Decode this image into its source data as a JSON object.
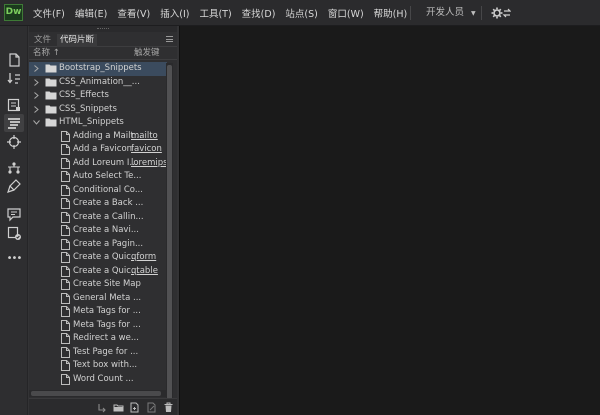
{
  "app": {
    "logo_text": "Dw",
    "logo_color": "#7dce5e",
    "menu": [
      "文件(F)",
      "编辑(E)",
      "查看(V)",
      "插入(I)",
      "工具(T)",
      "查找(D)",
      "站点(S)",
      "窗口(W)",
      "帮助(H)"
    ],
    "workspace_label": "开发人员",
    "sync_icon": "gear-sync-icon"
  },
  "toolbar": {
    "icons": [
      "file-icon",
      "file-transfer-icon",
      "split-view-icon",
      "live-view-icon",
      "snippets-icon",
      "target-icon",
      "dom-icon",
      "paint-icon",
      "comment-icon",
      "check-icon",
      "more-icon"
    ],
    "more_label": "•••"
  },
  "panel": {
    "tabs": [
      "文件",
      "代码片断"
    ],
    "active_tab": "代码片断",
    "col_name": "名称 ↑",
    "col_key": "触发键",
    "accent_selected": "#3b4b5e"
  },
  "snippets": [
    {
      "type": "folder",
      "label": "Bootstrap_Snippets",
      "expanded": false,
      "selected": true
    },
    {
      "type": "folder",
      "label": "CSS_Animation__...",
      "expanded": false
    },
    {
      "type": "folder",
      "label": "CSS_Effects",
      "expanded": false
    },
    {
      "type": "folder",
      "label": "CSS_Snippets",
      "expanded": false
    },
    {
      "type": "folder",
      "label": "HTML_Snippets",
      "expanded": true
    },
    {
      "type": "file",
      "label": "Adding a Mailt...",
      "key": "mailto"
    },
    {
      "type": "file",
      "label": "Add a Favicon",
      "key": "favicon"
    },
    {
      "type": "file",
      "label": "Add Loreum I...",
      "key": "loremipsum"
    },
    {
      "type": "file",
      "label": "Auto Select Te...",
      "key": ""
    },
    {
      "type": "file",
      "label": "Conditional Co...",
      "key": ""
    },
    {
      "type": "file",
      "label": "Create a Back ...",
      "key": ""
    },
    {
      "type": "file",
      "label": "Create a Callin...",
      "key": ""
    },
    {
      "type": "file",
      "label": "Create a Navi...",
      "key": ""
    },
    {
      "type": "file",
      "label": "Create a Pagin...",
      "key": ""
    },
    {
      "type": "file",
      "label": "Create a Quic...",
      "key": "qform"
    },
    {
      "type": "file",
      "label": "Create a Quic...",
      "key": "qtable"
    },
    {
      "type": "file",
      "label": "Create Site Map",
      "key": ""
    },
    {
      "type": "file",
      "label": "General Meta ...",
      "key": ""
    },
    {
      "type": "file",
      "label": "Meta Tags for ...",
      "key": ""
    },
    {
      "type": "file",
      "label": "Meta Tags for ...",
      "key": ""
    },
    {
      "type": "file",
      "label": "Redirect a we...",
      "key": ""
    },
    {
      "type": "file",
      "label": "Test Page for ...",
      "key": ""
    },
    {
      "type": "file",
      "label": "Text box with...",
      "key": ""
    },
    {
      "type": "file",
      "label": "Word Count ...",
      "key": ""
    }
  ],
  "panel_buttons": [
    "insert-icon",
    "new-folder-icon",
    "new-snippet-icon",
    "edit-snippet-icon",
    "delete-icon"
  ]
}
